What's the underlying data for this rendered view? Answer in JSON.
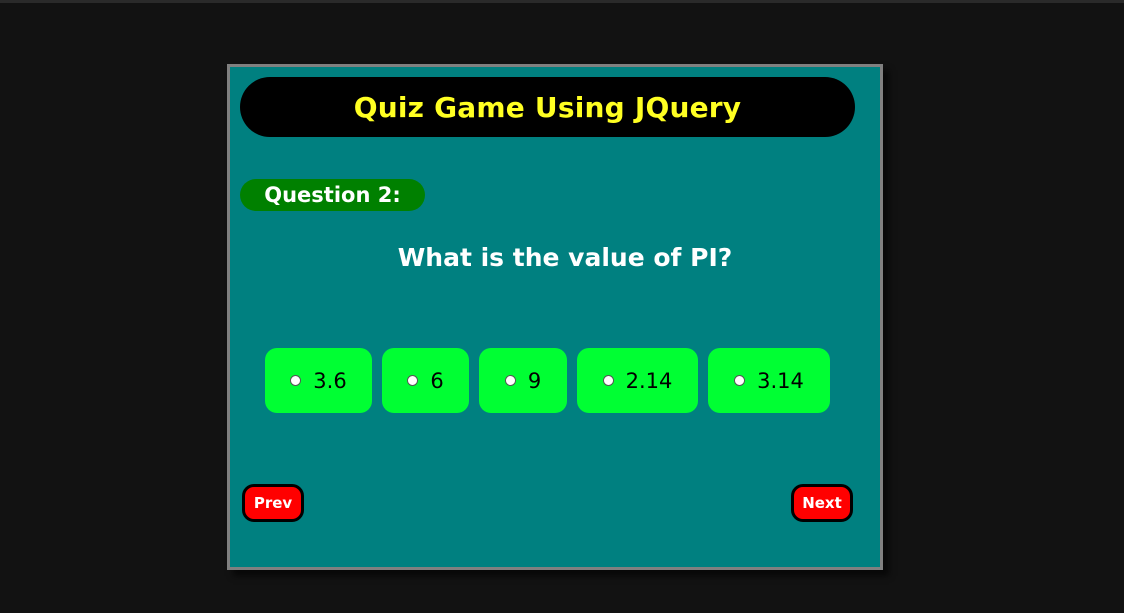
{
  "header": {
    "title": "Quiz Game Using JQuery"
  },
  "question": {
    "label": "Question 2:",
    "text": "What is the value of PI?"
  },
  "options": [
    {
      "label": "3.6"
    },
    {
      "label": "6"
    },
    {
      "label": "9"
    },
    {
      "label": "2.14"
    },
    {
      "label": "3.14"
    }
  ],
  "navigation": {
    "prev_label": "Prev",
    "next_label": "Next"
  },
  "colors": {
    "page_background": "#121212",
    "card_background": "#008080",
    "title_color": "#ffff22",
    "badge_background": "#008000",
    "option_background": "#00ff33",
    "button_background": "#ff0000"
  }
}
